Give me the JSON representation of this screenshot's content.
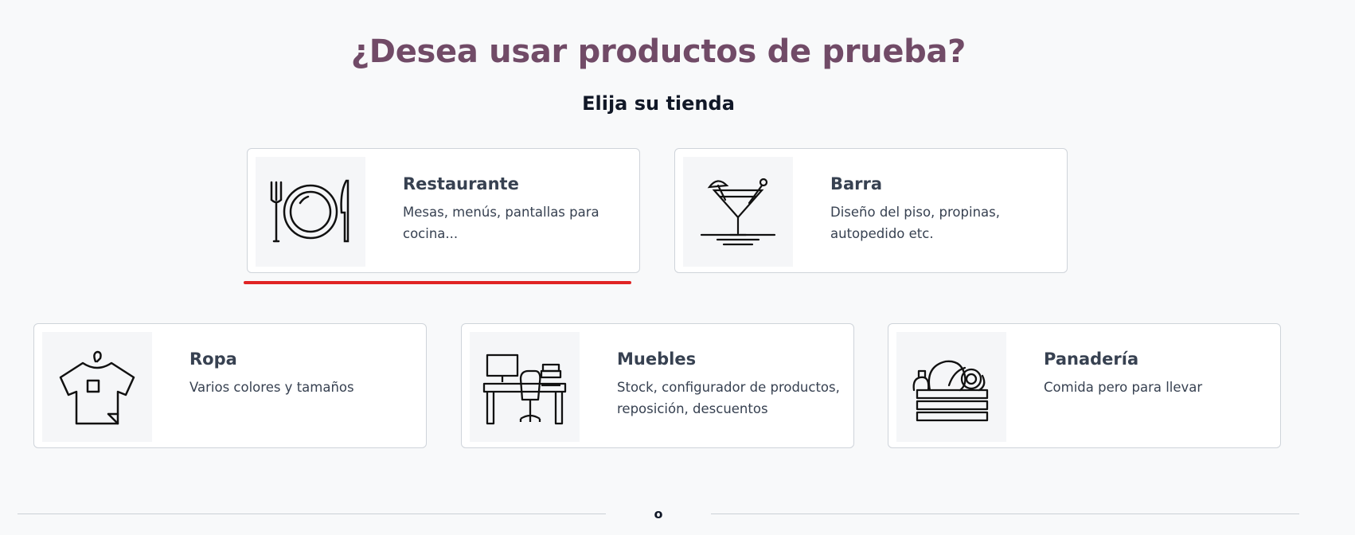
{
  "header": {
    "title": "¿Desea usar productos de prueba?",
    "subtitle": "Elija su tienda"
  },
  "shops": [
    {
      "name": "Restaurante",
      "description": "Mesas, menús, pantallas para cocina...",
      "icon": "restaurant-icon"
    },
    {
      "name": "Barra",
      "description": "Diseño del piso, propinas, autopedido etc.",
      "icon": "cocktail-icon"
    },
    {
      "name": "Ropa",
      "description": "Varios colores y tamaños",
      "icon": "shirt-icon"
    },
    {
      "name": "Muebles",
      "description": "Stock, configurador de productos, reposición, descuentos",
      "icon": "furniture-icon"
    },
    {
      "name": "Panadería",
      "description": "Comida pero para llevar",
      "icon": "bakery-icon"
    }
  ],
  "divider": {
    "text": "o"
  },
  "colors": {
    "title": "#714b67",
    "highlight": "#e02424"
  }
}
